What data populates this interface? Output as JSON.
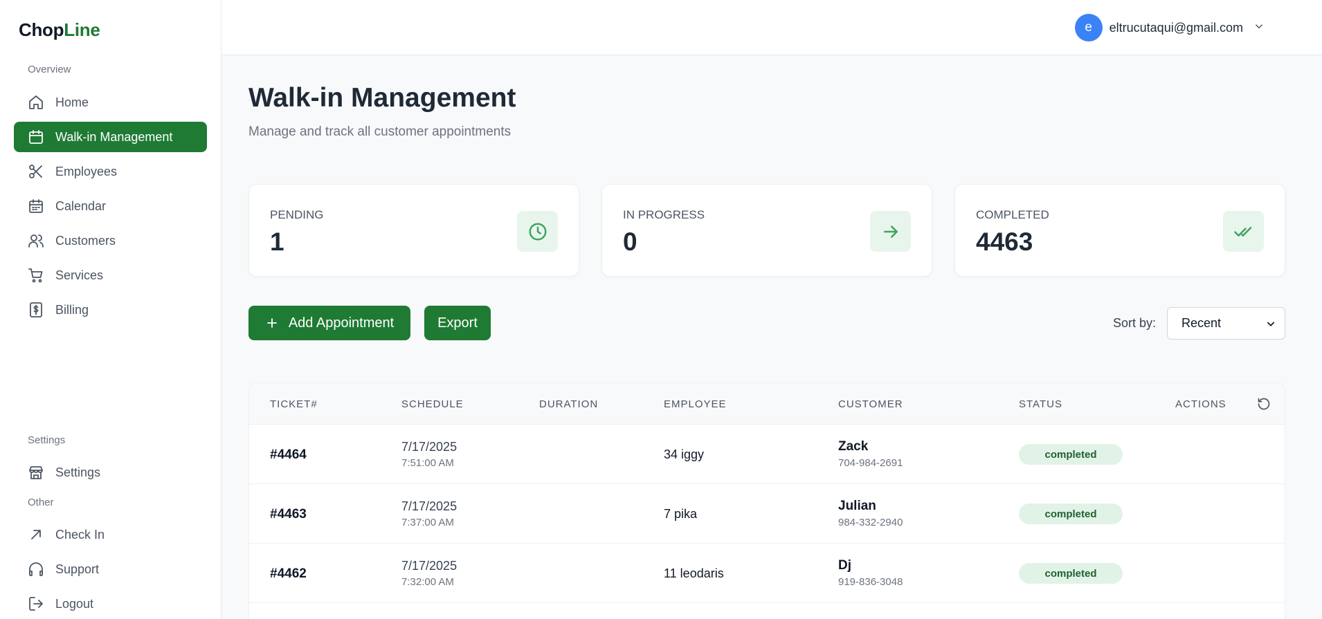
{
  "brand": {
    "part1": "Chop",
    "part2": "Line"
  },
  "sidebar": {
    "overview_label": "Overview",
    "settings_label": "Settings",
    "other_label": "Other",
    "items": [
      {
        "label": "Home",
        "icon": "home-icon"
      },
      {
        "label": "Walk-in Management",
        "icon": "calendar-icon",
        "active": true
      },
      {
        "label": "Employees",
        "icon": "scissors-icon"
      },
      {
        "label": "Calendar",
        "icon": "calendar-grid-icon"
      },
      {
        "label": "Customers",
        "icon": "users-icon"
      },
      {
        "label": "Services",
        "icon": "cart-icon"
      },
      {
        "label": "Billing",
        "icon": "dollar-receipt-icon"
      }
    ],
    "settings_items": [
      {
        "label": "Settings",
        "icon": "store-icon"
      }
    ],
    "other_items": [
      {
        "label": "Check In",
        "icon": "arrow-up-right-icon"
      },
      {
        "label": "Support",
        "icon": "headphones-icon"
      },
      {
        "label": "Logout",
        "icon": "logout-icon"
      }
    ]
  },
  "header": {
    "avatar_letter": "e",
    "user_email": "eltrucutaqui@gmail.com"
  },
  "page": {
    "title": "Walk-in Management",
    "subtitle": "Manage and track all customer appointments"
  },
  "stats": [
    {
      "label": "PENDING",
      "value": "1",
      "icon": "clock-icon"
    },
    {
      "label": "IN PROGRESS",
      "value": "0",
      "icon": "arrow-right-icon"
    },
    {
      "label": "COMPLETED",
      "value": "4463",
      "icon": "double-check-icon"
    }
  ],
  "actions": {
    "add_label": "Add Appointment",
    "export_label": "Export",
    "sort_label": "Sort by:",
    "sort_value": "Recent"
  },
  "table": {
    "columns": [
      "TICKET#",
      "SCHEDULE",
      "DURATION",
      "EMPLOYEE",
      "CUSTOMER",
      "STATUS",
      "ACTIONS"
    ],
    "rows": [
      {
        "ticket": "#4464",
        "date": "7/17/2025",
        "time": "7:51:00 AM",
        "duration": "",
        "employee": "34 iggy",
        "customer": "Zack",
        "phone": "704-984-2691",
        "status": "completed"
      },
      {
        "ticket": "#4463",
        "date": "7/17/2025",
        "time": "7:37:00 AM",
        "duration": "",
        "employee": "7 pika",
        "customer": "Julian",
        "phone": "984-332-2940",
        "status": "completed"
      },
      {
        "ticket": "#4462",
        "date": "7/17/2025",
        "time": "7:32:00 AM",
        "duration": "",
        "employee": "11 leodaris",
        "customer": "Dj",
        "phone": "919-836-3048",
        "status": "completed"
      }
    ]
  },
  "colors": {
    "brand_green": "#1f7a34",
    "avatar_blue": "#3b82f6",
    "status_bg": "#e1f3e6"
  }
}
